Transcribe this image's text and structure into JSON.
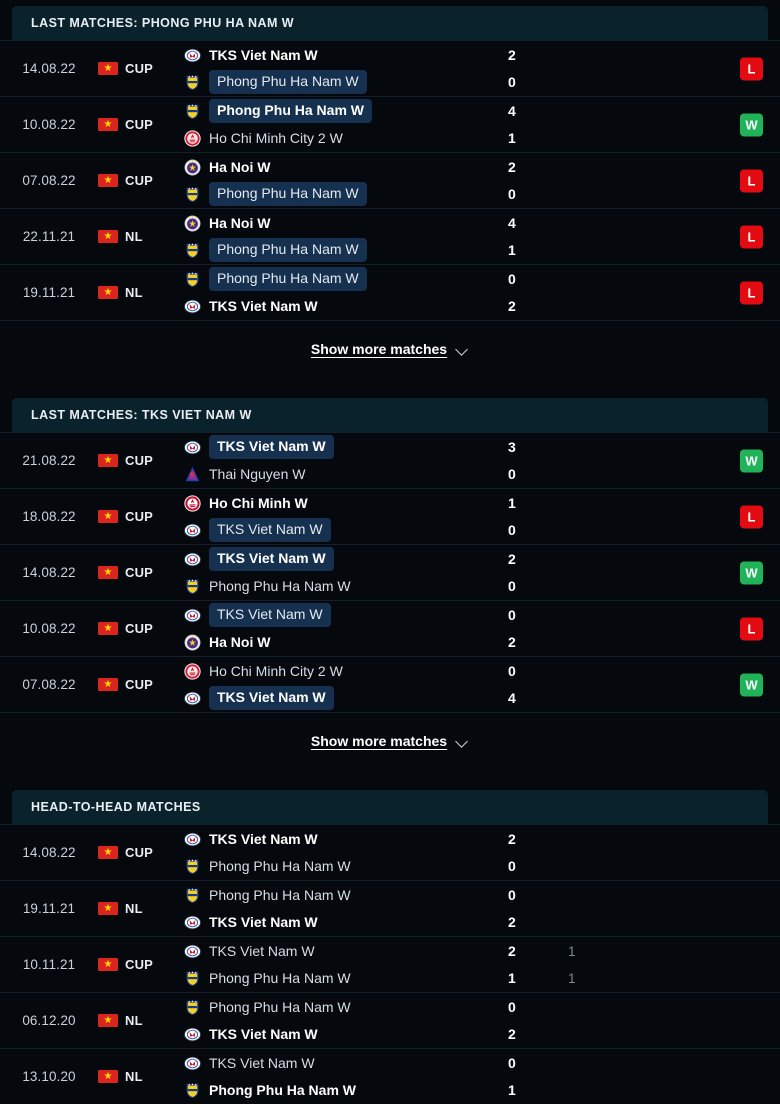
{
  "theme": {
    "background": "#05080d",
    "header_bg": "#0a222b",
    "row_divider": "#12202c",
    "highlight_bg": "#16304f",
    "win_color": "#21b35a",
    "loss_color": "#e20b12",
    "flag_red": "#da251d",
    "flag_star": "#ffdd00"
  },
  "sections": [
    {
      "id": "last-matches-phong-phu",
      "title": "LAST MATCHES: PHONG PHU HA NAM W",
      "show_more_label": "Show more matches",
      "show_more_icon": "chevron-down-icon",
      "matches": [
        {
          "date": "14.08.22",
          "flag": "vietnam-flag",
          "competition": "CUP",
          "home": {
            "name": "TKS Viet Nam W",
            "logo": "tks-viet-nam-crest",
            "bold": true,
            "highlighted": false
          },
          "away": {
            "name": "Phong Phu Ha Nam W",
            "logo": "phong-phu-crest",
            "bold": false,
            "highlighted": true
          },
          "home_score": "2",
          "away_score": "0",
          "home_score_ht": "",
          "away_score_ht": "",
          "result": "L"
        },
        {
          "date": "10.08.22",
          "flag": "vietnam-flag",
          "competition": "CUP",
          "home": {
            "name": "Phong Phu Ha Nam W",
            "logo": "phong-phu-crest",
            "bold": true,
            "highlighted": true
          },
          "away": {
            "name": "Ho Chi Minh City 2 W",
            "logo": "ho-chi-minh-2-crest",
            "bold": false,
            "highlighted": false
          },
          "home_score": "4",
          "away_score": "1",
          "home_score_ht": "",
          "away_score_ht": "",
          "result": "W"
        },
        {
          "date": "07.08.22",
          "flag": "vietnam-flag",
          "competition": "CUP",
          "home": {
            "name": "Ha Noi W",
            "logo": "ha-noi-crest",
            "bold": true,
            "highlighted": false
          },
          "away": {
            "name": "Phong Phu Ha Nam W",
            "logo": "phong-phu-crest",
            "bold": false,
            "highlighted": true
          },
          "home_score": "2",
          "away_score": "0",
          "home_score_ht": "",
          "away_score_ht": "",
          "result": "L"
        },
        {
          "date": "22.11.21",
          "flag": "vietnam-flag",
          "competition": "NL",
          "home": {
            "name": "Ha Noi W",
            "logo": "ha-noi-crest",
            "bold": true,
            "highlighted": false
          },
          "away": {
            "name": "Phong Phu Ha Nam W",
            "logo": "phong-phu-crest",
            "bold": false,
            "highlighted": true
          },
          "home_score": "4",
          "away_score": "1",
          "home_score_ht": "",
          "away_score_ht": "",
          "result": "L"
        },
        {
          "date": "19.11.21",
          "flag": "vietnam-flag",
          "competition": "NL",
          "home": {
            "name": "Phong Phu Ha Nam W",
            "logo": "phong-phu-crest",
            "bold": false,
            "highlighted": true
          },
          "away": {
            "name": "TKS Viet Nam W",
            "logo": "tks-viet-nam-crest",
            "bold": true,
            "highlighted": false
          },
          "home_score": "0",
          "away_score": "2",
          "home_score_ht": "",
          "away_score_ht": "",
          "result": "L"
        }
      ]
    },
    {
      "id": "last-matches-tks-viet-nam",
      "title": "LAST MATCHES: TKS VIET NAM W",
      "show_more_label": "Show more matches",
      "show_more_icon": "chevron-down-icon",
      "matches": [
        {
          "date": "21.08.22",
          "flag": "vietnam-flag",
          "competition": "CUP",
          "home": {
            "name": "TKS Viet Nam W",
            "logo": "tks-viet-nam-crest",
            "bold": true,
            "highlighted": true
          },
          "away": {
            "name": "Thai Nguyen W",
            "logo": "thai-nguyen-crest",
            "bold": false,
            "highlighted": false
          },
          "home_score": "3",
          "away_score": "0",
          "home_score_ht": "",
          "away_score_ht": "",
          "result": "W"
        },
        {
          "date": "18.08.22",
          "flag": "vietnam-flag",
          "competition": "CUP",
          "home": {
            "name": "Ho Chi Minh W",
            "logo": "ho-chi-minh-crest",
            "bold": true,
            "highlighted": false
          },
          "away": {
            "name": "TKS Viet Nam W",
            "logo": "tks-viet-nam-crest",
            "bold": false,
            "highlighted": true
          },
          "home_score": "1",
          "away_score": "0",
          "home_score_ht": "",
          "away_score_ht": "",
          "result": "L"
        },
        {
          "date": "14.08.22",
          "flag": "vietnam-flag",
          "competition": "CUP",
          "home": {
            "name": "TKS Viet Nam W",
            "logo": "tks-viet-nam-crest",
            "bold": true,
            "highlighted": true
          },
          "away": {
            "name": "Phong Phu Ha Nam W",
            "logo": "phong-phu-crest",
            "bold": false,
            "highlighted": false
          },
          "home_score": "2",
          "away_score": "0",
          "home_score_ht": "",
          "away_score_ht": "",
          "result": "W"
        },
        {
          "date": "10.08.22",
          "flag": "vietnam-flag",
          "competition": "CUP",
          "home": {
            "name": "TKS Viet Nam W",
            "logo": "tks-viet-nam-crest",
            "bold": false,
            "highlighted": true
          },
          "away": {
            "name": "Ha Noi W",
            "logo": "ha-noi-crest",
            "bold": true,
            "highlighted": false
          },
          "home_score": "0",
          "away_score": "2",
          "home_score_ht": "",
          "away_score_ht": "",
          "result": "L"
        },
        {
          "date": "07.08.22",
          "flag": "vietnam-flag",
          "competition": "CUP",
          "home": {
            "name": "Ho Chi Minh City 2 W",
            "logo": "ho-chi-minh-2-crest",
            "bold": false,
            "highlighted": false
          },
          "away": {
            "name": "TKS Viet Nam W",
            "logo": "tks-viet-nam-crest",
            "bold": true,
            "highlighted": true
          },
          "home_score": "0",
          "away_score": "4",
          "home_score_ht": "",
          "away_score_ht": "",
          "result": "W"
        }
      ]
    },
    {
      "id": "head-to-head-matches",
      "title": "HEAD-TO-HEAD MATCHES",
      "show_more_label": "",
      "show_more_icon": "",
      "matches": [
        {
          "date": "14.08.22",
          "flag": "vietnam-flag",
          "competition": "CUP",
          "home": {
            "name": "TKS Viet Nam W",
            "logo": "tks-viet-nam-crest",
            "bold": true,
            "highlighted": false
          },
          "away": {
            "name": "Phong Phu Ha Nam W",
            "logo": "phong-phu-crest",
            "bold": false,
            "highlighted": false
          },
          "home_score": "2",
          "away_score": "0",
          "home_score_ht": "",
          "away_score_ht": "",
          "result": ""
        },
        {
          "date": "19.11.21",
          "flag": "vietnam-flag",
          "competition": "NL",
          "home": {
            "name": "Phong Phu Ha Nam W",
            "logo": "phong-phu-crest",
            "bold": false,
            "highlighted": false
          },
          "away": {
            "name": "TKS Viet Nam W",
            "logo": "tks-viet-nam-crest",
            "bold": true,
            "highlighted": false
          },
          "home_score": "0",
          "away_score": "2",
          "home_score_ht": "",
          "away_score_ht": "",
          "result": ""
        },
        {
          "date": "10.11.21",
          "flag": "vietnam-flag",
          "competition": "CUP",
          "home": {
            "name": "TKS Viet Nam W",
            "logo": "tks-viet-nam-crest",
            "bold": false,
            "highlighted": false
          },
          "away": {
            "name": "Phong Phu Ha Nam W",
            "logo": "phong-phu-crest",
            "bold": false,
            "highlighted": false
          },
          "home_score": "2",
          "away_score": "1",
          "home_score_ht": "1",
          "away_score_ht": "1",
          "result": ""
        },
        {
          "date": "06.12.20",
          "flag": "vietnam-flag",
          "competition": "NL",
          "home": {
            "name": "Phong Phu Ha Nam W",
            "logo": "phong-phu-crest",
            "bold": false,
            "highlighted": false
          },
          "away": {
            "name": "TKS Viet Nam W",
            "logo": "tks-viet-nam-crest",
            "bold": true,
            "highlighted": false
          },
          "home_score": "0",
          "away_score": "2",
          "home_score_ht": "",
          "away_score_ht": "",
          "result": ""
        },
        {
          "date": "13.10.20",
          "flag": "vietnam-flag",
          "competition": "NL",
          "home": {
            "name": "TKS Viet Nam W",
            "logo": "tks-viet-nam-crest",
            "bold": false,
            "highlighted": false
          },
          "away": {
            "name": "Phong Phu Ha Nam W",
            "logo": "phong-phu-crest",
            "bold": true,
            "highlighted": false
          },
          "home_score": "0",
          "away_score": "1",
          "home_score_ht": "",
          "away_score_ht": "",
          "result": ""
        }
      ]
    }
  ]
}
